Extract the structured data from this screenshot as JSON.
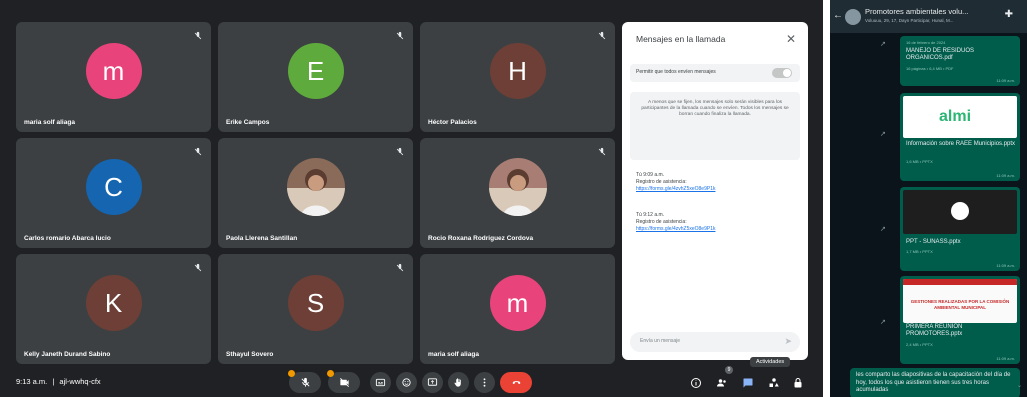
{
  "meet": {
    "participants": [
      {
        "name": "maria solf aliaga",
        "initial": "m",
        "color": "#e8437a",
        "photo": false,
        "muted": true
      },
      {
        "name": "Erike Campos",
        "initial": "E",
        "color": "#5eaa3c",
        "photo": false,
        "muted": true
      },
      {
        "name": "Héctor Palacios",
        "initial": "H",
        "color": "#6d3f36",
        "photo": false,
        "muted": true
      },
      {
        "name": "Carlos romario Abarca lucio",
        "initial": "C",
        "color": "#1565b0",
        "photo": false,
        "muted": true
      },
      {
        "name": "Paola Llerena Santillan",
        "initial": "",
        "color": "#8a6b5a",
        "photo": true,
        "muted": true
      },
      {
        "name": "Rocio Roxana Rodriguez Cordova",
        "initial": "",
        "color": "#a87d74",
        "photo": true,
        "muted": true
      },
      {
        "name": "Kelly Janeth Durand Sabino",
        "initial": "K",
        "color": "#6d3f36",
        "photo": false,
        "muted": true
      },
      {
        "name": "Sthayul Sovero",
        "initial": "S",
        "color": "#6d3f36",
        "photo": false,
        "muted": true
      },
      {
        "name": "maria solf aliaga",
        "initial": "m",
        "color": "#e8437a",
        "photo": false,
        "muted": false
      }
    ],
    "chat": {
      "title": "Mensajes en la llamada",
      "close_icon": "close-icon",
      "permission_label": "Permitir que todos envíen mensajes",
      "notice": "A menos que se fijen, los mensajes solo serán visibles para los participantes de la llamada cuando se envíen. Todos los mensajes se borran cuando finaliza la llamada.",
      "messages": [
        {
          "sender": "Tú",
          "time": "9:09 a.m.",
          "text": "Registro de asistencia:",
          "link": "https://forms.gle/4zvhZ5xeO8e9P1k"
        },
        {
          "sender": "Tú",
          "time": "9:12 a.m.",
          "text": "Registro de asistencia:",
          "link": "https://forms.gle/4zvhZ5xeO8e9P1k"
        }
      ],
      "input_placeholder": "Envía un mensaje"
    },
    "bottom": {
      "time": "9:13 a.m.",
      "separator": "|",
      "meeting_code": "ajl-wwhq-cfx",
      "tooltip": "Actividades",
      "people_badge": "9"
    }
  },
  "whatsapp": {
    "group_name": "Promotores ambientales volu...",
    "members": "Voluuuu, 29, 17, Dayn Participar, Hunal, M...",
    "date_label": "16 de febrero de 2024",
    "documents": [
      {
        "title": "MANEJO DE RESIDUOS ORGANICOS.pdf",
        "meta": "16 páginas • 6,4 MB • PDF",
        "time": "11:09 a.m."
      },
      {
        "title": "Información sobre RAEE Municipios.pptx",
        "meta": "1,6 MB • PPTX",
        "time": "11:09 a.m."
      },
      {
        "title": "PPT - SUNASS.pptx",
        "meta": "1,7 MB • PPTX",
        "time": "11:09 a.m."
      },
      {
        "title": "PRIMERA REUNION PROMOTORES.pptx",
        "meta": "2,4 MB • PPTX",
        "time": "11:09 a.m."
      }
    ],
    "thumb_text_almi": "almi",
    "thumb_text_gestiones": "GESTIONES REALIZADAS POR LA COMISIÓN AMBIENTAL MUNICIPAL",
    "last_message": "les comparto las diapositivas de la capacitación del día de hoy, todos los que asistieron tienen sus tres horas acumuladas"
  },
  "colors": {
    "meet_bg": "#202124",
    "tile_bg": "#3c4043",
    "leave_red": "#ea4335",
    "link_blue": "#1a73e8",
    "wa_bubble": "#005c4b",
    "wa_bg": "#0b141a"
  }
}
